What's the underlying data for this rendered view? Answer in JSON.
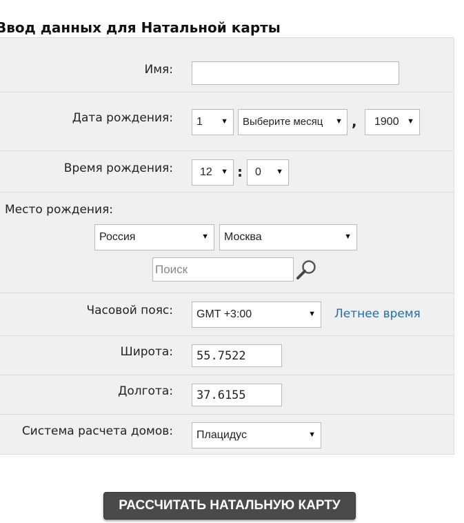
{
  "page": {
    "title": "Ввод данных для Натальной карты"
  },
  "form": {
    "name": {
      "label": "Имя:",
      "value": ""
    },
    "birth_date": {
      "label": "Дата рождения:",
      "day": "1",
      "month": "Выберите месяц",
      "separator": ",",
      "year": "1900"
    },
    "birth_time": {
      "label": "Время рождения:",
      "hour": "12",
      "separator": ":",
      "minute": "0"
    },
    "birth_place": {
      "label": "Место рождения:",
      "country": "Россия",
      "city": "Москва",
      "search_placeholder": "Поиск"
    },
    "timezone": {
      "label": "Часовой пояс:",
      "value": "GMT +3:00",
      "dst_link": "Летнее время"
    },
    "latitude": {
      "label": "Широта:",
      "value": "55.7522"
    },
    "longitude": {
      "label": "Долгота:",
      "value": "37.6155"
    },
    "house_system": {
      "label": "Система расчета домов:",
      "value": "Плацидус"
    }
  },
  "submit": {
    "label": "РАССЧИТАТЬ НАТАЛЬНУЮ КАРТУ"
  },
  "icons": {
    "arrow": "▼",
    "search": "search-icon"
  },
  "colors": {
    "panel": "#f0f0f0",
    "link": "#1f6fa8",
    "button": "#4a4a4a"
  }
}
